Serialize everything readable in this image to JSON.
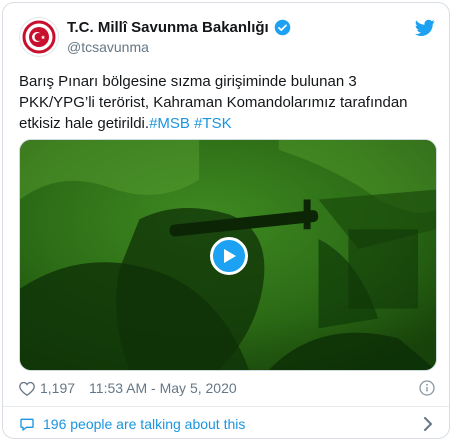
{
  "account": {
    "display_name": "T.C. Millî Savunma Bakanlığı",
    "handle": "@tcsavunma",
    "avatar_icon": "ministry-seal-icon",
    "verified_icon": "verified-badge-icon"
  },
  "tweet": {
    "text": "Barış Pınarı bölgesine sızma girişiminde bulunan 3 PKK/YPG’li terörist, Kahraman Komandolarımız tarafından etkisiz hale getirildi.",
    "hashtags": [
      "#MSB",
      "#TSK"
    ]
  },
  "media": {
    "type": "video",
    "play_icon": "play-icon"
  },
  "meta": {
    "like_count": "1,197",
    "timestamp": "11:53 AM - May 5, 2020"
  },
  "footer": {
    "talk_label": "196 people are talking about this"
  },
  "colors": {
    "accent": "#1da1f2",
    "link": "#1b95e0",
    "secondary_text": "#657786",
    "heart": "#657786",
    "video_green": "#2c6a14"
  }
}
